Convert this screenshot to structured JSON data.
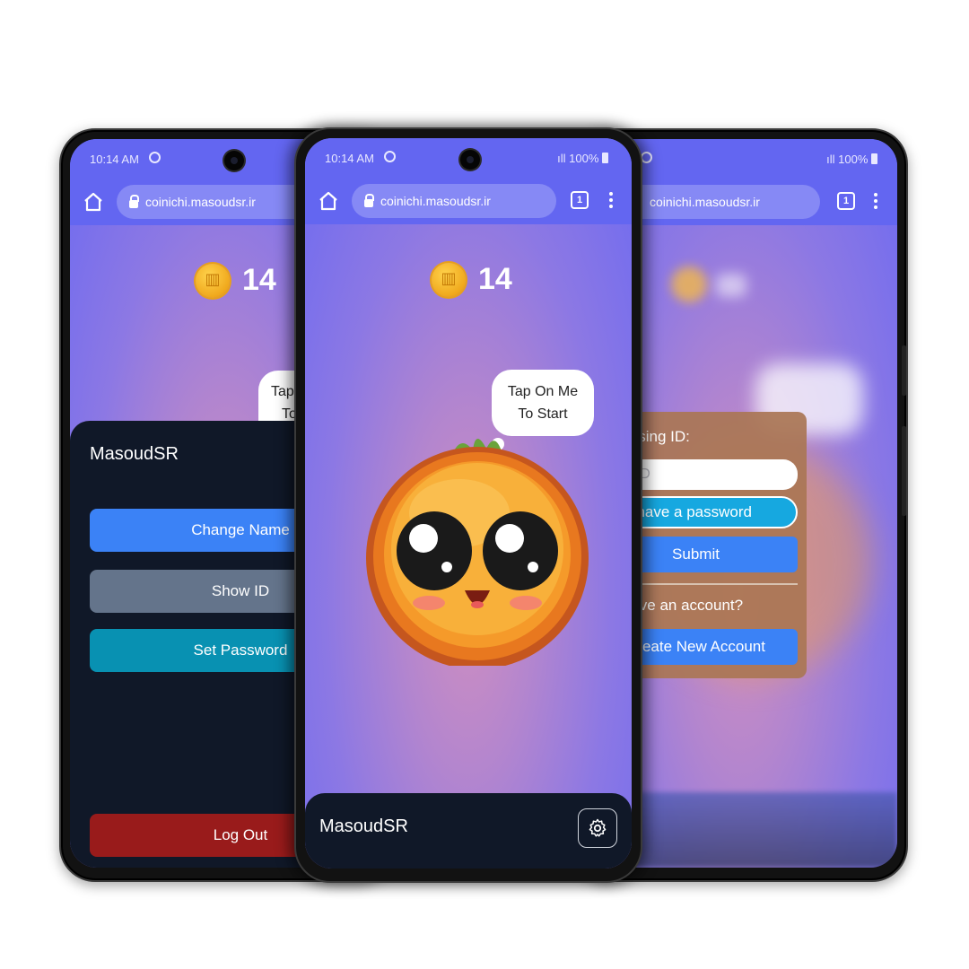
{
  "status": {
    "time": "10:14 AM",
    "time_partial": "M",
    "battery": "100%"
  },
  "browser": {
    "url": "coinichi.masoudsr.ir",
    "tab_count": "1"
  },
  "game": {
    "score": "14",
    "bubble_line1": "Tap On Me",
    "bubble_line2": "To Start",
    "bubble_cut_line1": "Tap",
    "bubble_cut_line2": "To"
  },
  "profile_sheet": {
    "username": "MasoudSR",
    "change_name": "Change Name",
    "show_id": "Show ID",
    "set_password": "Set Password",
    "logout": "Log Out"
  },
  "footer": {
    "username": "MasoudSR"
  },
  "login": {
    "title": "Signin Using ID:",
    "id_placeholder": "Your ID",
    "password_toggle": "I have a password",
    "submit": "Submit",
    "no_account": "Don't have an account?",
    "create_account": "Create New Account"
  },
  "colors": {
    "accent": "#6366f1",
    "sheet_bg": "#101828",
    "btn_blue": "#3b82f6",
    "btn_gray": "#64748b",
    "btn_teal": "#0891b2",
    "btn_red": "#991b1b"
  }
}
